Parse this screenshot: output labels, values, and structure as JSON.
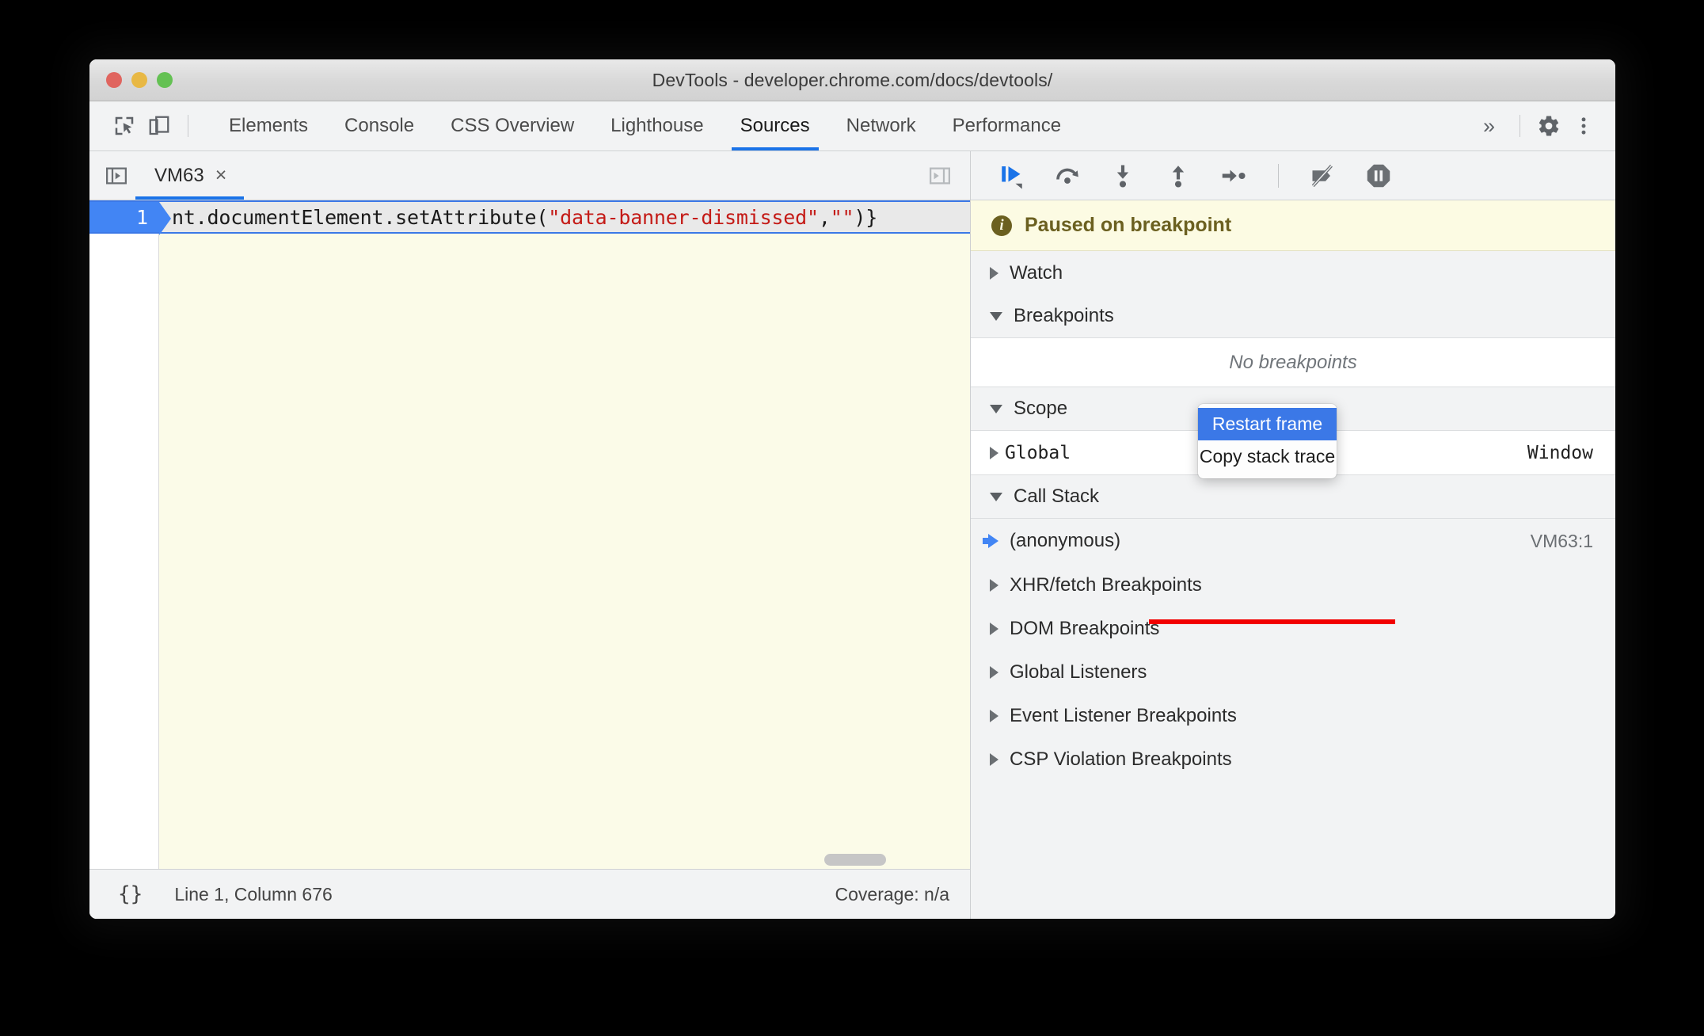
{
  "window": {
    "title": "DevTools - developer.chrome.com/docs/devtools/",
    "traffic_lights": [
      "close",
      "minimize",
      "zoom"
    ]
  },
  "toolbar": {
    "inspect_icon": "inspect-element-icon",
    "device_icon": "device-toolbar-icon",
    "more_tabs_label": "»",
    "settings_icon": "gear-icon",
    "menu_icon": "kebab-menu-icon",
    "tabs": [
      {
        "label": "Elements",
        "active": false
      },
      {
        "label": "Console",
        "active": false
      },
      {
        "label": "CSS Overview",
        "active": false
      },
      {
        "label": "Lighthouse",
        "active": false
      },
      {
        "label": "Sources",
        "active": true
      },
      {
        "label": "Network",
        "active": false
      },
      {
        "label": "Performance",
        "active": false
      }
    ]
  },
  "editor": {
    "navigator_toggle_icon": "show-navigator-icon",
    "debugger_toggle_icon": "show-debugger-icon",
    "file_tab": {
      "name": "VM63",
      "close_label": "×"
    },
    "line_number": "1",
    "code": {
      "before": "nt.documentElement.setAttribute(",
      "string1": "\"data-banner-dismissed\"",
      "comma": ",",
      "string2": "\"\"",
      "after": ")}"
    }
  },
  "status_bar": {
    "format_label": "{}",
    "cursor_position": "Line 1, Column 676",
    "coverage": "Coverage: n/a"
  },
  "debugger": {
    "controls": [
      {
        "name": "resume-script-execution",
        "icon": "resume-icon"
      },
      {
        "name": "step-over-next-function-call",
        "icon": "step-over-icon"
      },
      {
        "name": "step-into-next-function-call",
        "icon": "step-into-icon"
      },
      {
        "name": "step-out-of-current-function",
        "icon": "step-out-icon"
      },
      {
        "name": "step",
        "icon": "step-icon"
      },
      {
        "name": "deactivate-breakpoints",
        "icon": "deactivate-breakpoints-icon"
      },
      {
        "name": "pause-on-exceptions",
        "icon": "pause-on-exceptions-icon"
      }
    ],
    "paused_banner": {
      "icon": "info-icon",
      "text": "Paused on breakpoint"
    },
    "sections": {
      "watch": {
        "label": "Watch",
        "expanded": false
      },
      "breakpoints": {
        "label": "Breakpoints",
        "expanded": true,
        "empty_text": "No breakpoints"
      },
      "scope": {
        "label": "Scope",
        "expanded": true
      },
      "call_stack": {
        "label": "Call Stack",
        "expanded": true
      },
      "xhr_fetch": {
        "label": "XHR/fetch Breakpoints",
        "expanded": false
      },
      "dom": {
        "label": "DOM Breakpoints",
        "expanded": false
      },
      "global_listeners": {
        "label": "Global Listeners",
        "expanded": false
      },
      "event_listener": {
        "label": "Event Listener Breakpoints",
        "expanded": false
      },
      "csp_violation": {
        "label": "CSP Violation Breakpoints",
        "expanded": false
      }
    },
    "scope_rows": [
      {
        "name": "Global",
        "value": "Window"
      }
    ],
    "call_stack_frames": [
      {
        "name": "(anonymous)",
        "location": "VM63:1",
        "current": true
      }
    ]
  },
  "context_menu": {
    "items": [
      {
        "label": "Restart frame",
        "selected": true,
        "struck_through": true
      },
      {
        "label": "Copy stack trace",
        "selected": false,
        "struck_through": false
      }
    ]
  },
  "colors": {
    "accent_blue": "#1a73e8",
    "selection_blue": "#3b78e7",
    "strike_red": "#f20000",
    "paused_bg": "#fcfbe3",
    "paused_text": "#6b6020",
    "code_string": "#c41a16",
    "editor_bg": "#fbfbe8"
  }
}
